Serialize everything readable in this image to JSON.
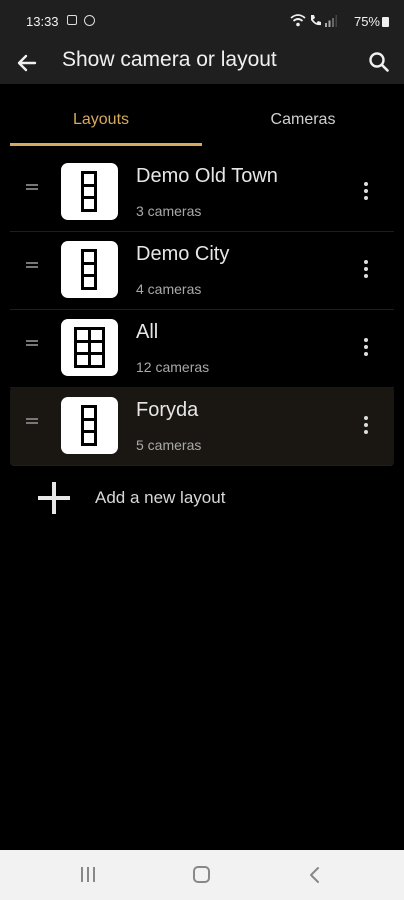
{
  "status_bar": {
    "time": "13:33",
    "battery": "75%",
    "icons": [
      "image-icon",
      "assistant-icon",
      "wifi-icon",
      "call-icon",
      "signal-icon",
      "battery-icon"
    ]
  },
  "app_bar": {
    "title": "Show camera or layout",
    "back_icon": "arrow-left-icon",
    "search_icon": "search-icon"
  },
  "tabs": [
    {
      "label": "Layouts",
      "active": true
    },
    {
      "label": "Cameras",
      "active": false
    }
  ],
  "accent_color": "#d7a95e",
  "layouts": [
    {
      "name": "Demo Old Town",
      "count": "3 cameras",
      "grid": "1x3",
      "selected": false
    },
    {
      "name": "Demo City",
      "count": "4 cameras",
      "grid": "1x3",
      "selected": false
    },
    {
      "name": "All",
      "count": "12 cameras",
      "grid": "2x3",
      "selected": false
    },
    {
      "name": "Foryda",
      "count": "5 cameras",
      "grid": "1x3",
      "selected": true
    }
  ],
  "add_layout": {
    "label": "Add a new layout",
    "icon": "plus-icon"
  },
  "nav_bar": {
    "icons": [
      "recents-icon",
      "home-icon",
      "back-icon"
    ]
  }
}
